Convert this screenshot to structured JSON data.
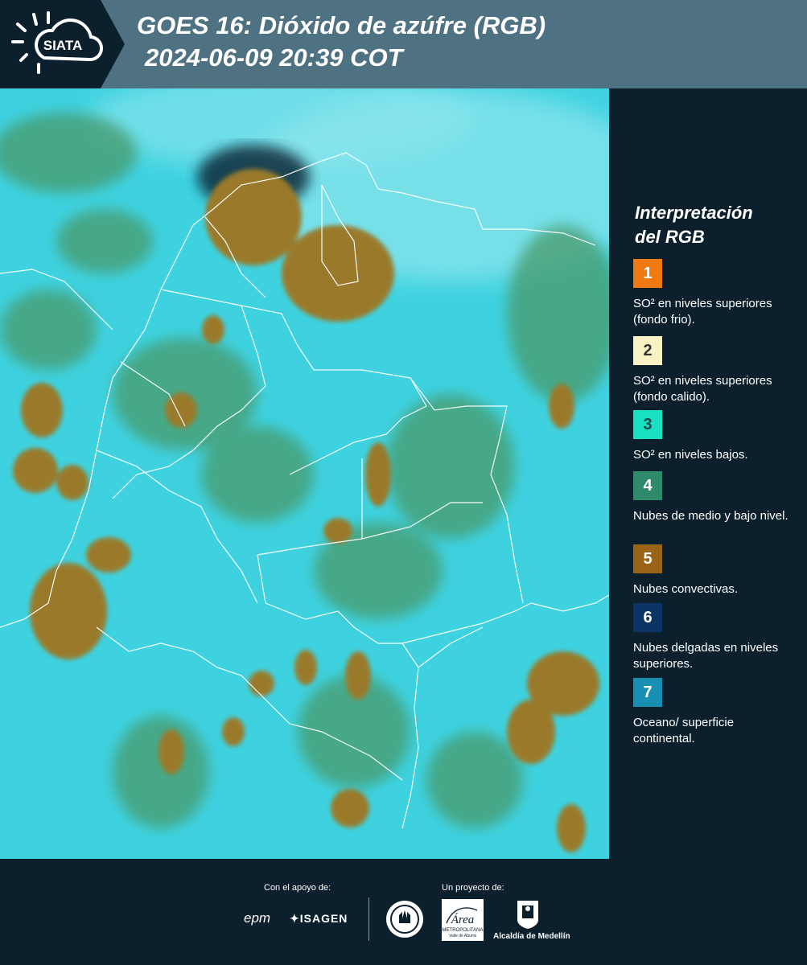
{
  "header": {
    "logo_text": "SIATA",
    "title_line1": "GOES 16: Dióxido de azúfre (RGB)",
    "title_line2": "2024-06-09 20:39 COT"
  },
  "legend": {
    "title_line1": "Interpretación",
    "title_line2": "del RGB",
    "items": [
      {
        "number": "1",
        "color": "#f07a10",
        "text": "SO² en niveles superiores (fondo frio)."
      },
      {
        "number": "2",
        "color": "#f8f2c4",
        "text": "SO² en niveles superiores (fondo calido)."
      },
      {
        "number": "3",
        "color": "#19e0c0",
        "text": "SO² en niveles bajos."
      },
      {
        "number": "4",
        "color": "#2f8a6a",
        "text": "Nubes de medio y bajo nivel."
      },
      {
        "number": "5",
        "color": "#9a6418",
        "text": "Nubes convectivas."
      },
      {
        "number": "6",
        "color": "#0d3466",
        "text": "Nubes delgadas en niveles superiores."
      },
      {
        "number": "7",
        "color": "#1a8fb4",
        "text": "Oceano/ superficie continental."
      }
    ]
  },
  "footer": {
    "support_label": "Con el apoyo de:",
    "project_label": "Un proyecto de:",
    "sponsor1": "epm",
    "sponsor2": "ISAGEN",
    "partner1_line1": "Área",
    "partner1_line2": "METROPOLITANA",
    "partner1_line3": "Valle de Aburrá",
    "partner2": "Alcaldía de Medellín"
  },
  "colors": {
    "header_bg": "#4e7282",
    "panel_bg": "#0c1f2c",
    "map_base": "#3ed2e0",
    "convective": "#9a7a2a",
    "mid_cloud": "#4a9a6a"
  }
}
